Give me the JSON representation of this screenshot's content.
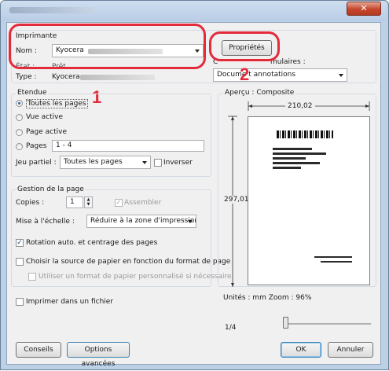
{
  "printer": {
    "group_label": "Imprimante",
    "name_label": "Nom :",
    "name_value": "Kyocera",
    "state_label": "État :",
    "state_value": "Prêt",
    "type_label": "Type :",
    "type_value": "Kyocera",
    "properties_button": "Propriétés",
    "comments_label": "C",
    "forms_label": "mulaires :",
    "forms_value": "Docume   t annotations"
  },
  "range": {
    "group_label": "Etendue",
    "options": [
      {
        "label": "Toutes les pages",
        "selected": true
      },
      {
        "label": "Vue active",
        "selected": false
      },
      {
        "label": "Page active",
        "selected": false
      },
      {
        "label": "Pages",
        "selected": false
      }
    ],
    "pages_value": "1 - 4",
    "subset_label": "Jeu partiel :",
    "subset_value": "Toutes les pages",
    "reverse_label": "Inverser"
  },
  "handling": {
    "group_label": "Gestion de la page",
    "copies_label": "Copies :",
    "copies_value": "1",
    "collate_label": "Assembler",
    "scale_label": "Mise à l'échelle :",
    "scale_value": "Réduire à la zone d'impression",
    "autorotate_label": "Rotation auto. et centrage des pages",
    "choose_source_label": "Choisir la source de papier en fonction du format de page",
    "custom_size_label": "Utiliser un format de papier personnalisé si nécessaire"
  },
  "print_to_file_label": "Imprimer dans un fichier",
  "preview": {
    "label": "Aperçu : Composite",
    "width_value": "210,02",
    "height_value": "297,01",
    "units_text": "Unités : mm Zoom :  96%",
    "page_indicator": "1/4"
  },
  "buttons": {
    "tips": "Conseils",
    "advanced": "Options avancées",
    "ok": "OK",
    "cancel": "Annuler"
  },
  "callouts": {
    "one": "1",
    "two": "2"
  },
  "colors": {
    "callout_red": "#e32b3b",
    "titlebar": "#b9cde6",
    "close_button": "#c5452b"
  }
}
